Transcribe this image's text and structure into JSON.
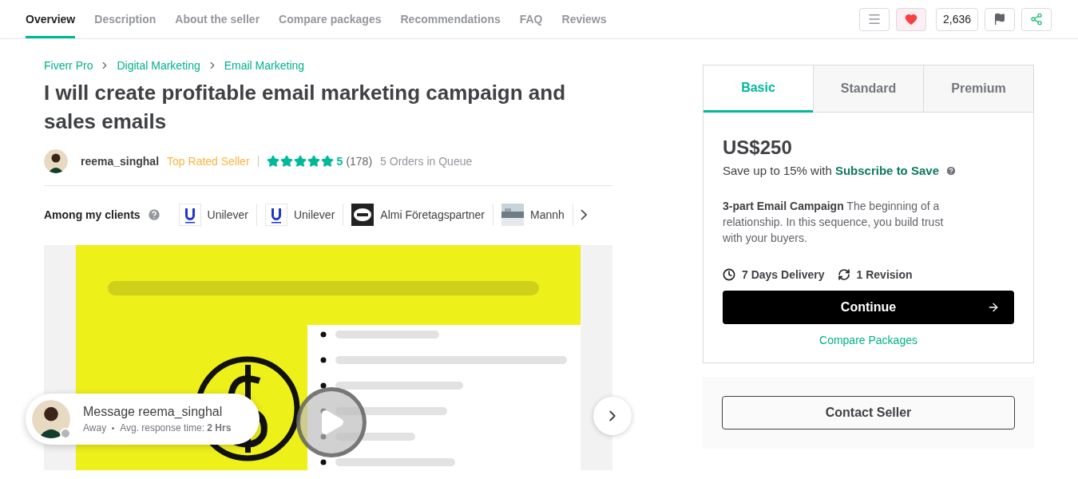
{
  "nav": {
    "tabs": [
      {
        "label": "Overview",
        "selected": true
      },
      {
        "label": "Description",
        "selected": false
      },
      {
        "label": "About the seller",
        "selected": false
      },
      {
        "label": "Compare packages",
        "selected": false
      },
      {
        "label": "Recommendations",
        "selected": false
      },
      {
        "label": "FAQ",
        "selected": false
      },
      {
        "label": "Reviews",
        "selected": false
      }
    ],
    "liked": true,
    "likes": "2,636"
  },
  "breadcrumbs": [
    "Fiverr Pro",
    "Digital Marketing",
    "Email Marketing"
  ],
  "title": "I will create profitable email marketing campaign and sales emails",
  "seller": {
    "name": "reema_singhal",
    "badge": "Top Rated Seller",
    "stars": 5,
    "rating": "5",
    "reviews": "(178)",
    "queue": "5 Orders in Queue"
  },
  "clients": {
    "label": "Among my clients",
    "items": [
      {
        "name": "Unilever",
        "kind": "unilever"
      },
      {
        "name": "Unilever",
        "kind": "unilever"
      },
      {
        "name": "Almi Företagspartner",
        "kind": "almi"
      },
      {
        "name": "Mannh",
        "kind": "picture"
      }
    ]
  },
  "media": {
    "kind": "picture"
  },
  "message": {
    "title": "Message reema_singhal",
    "status": "Away",
    "online": false,
    "response": "Avg. response time: **2 Hrs**"
  },
  "packages": {
    "tabs": [
      {
        "label": "Basic",
        "selected": true
      },
      {
        "label": "Standard",
        "selected": false
      },
      {
        "label": "Premium",
        "selected": false
      }
    ],
    "price": "US$250",
    "save": "Save up to 15% with",
    "save_link": "Subscribe to Save",
    "description": "**3-part Email Campaign** The beginning of a relationship. In this sequence, you build trust with your buyers.",
    "delivery": "7 Days Delivery",
    "revisions": "1 Revision",
    "button": "Continue",
    "compare": "Compare Packages"
  },
  "contact": "Contact Seller"
}
